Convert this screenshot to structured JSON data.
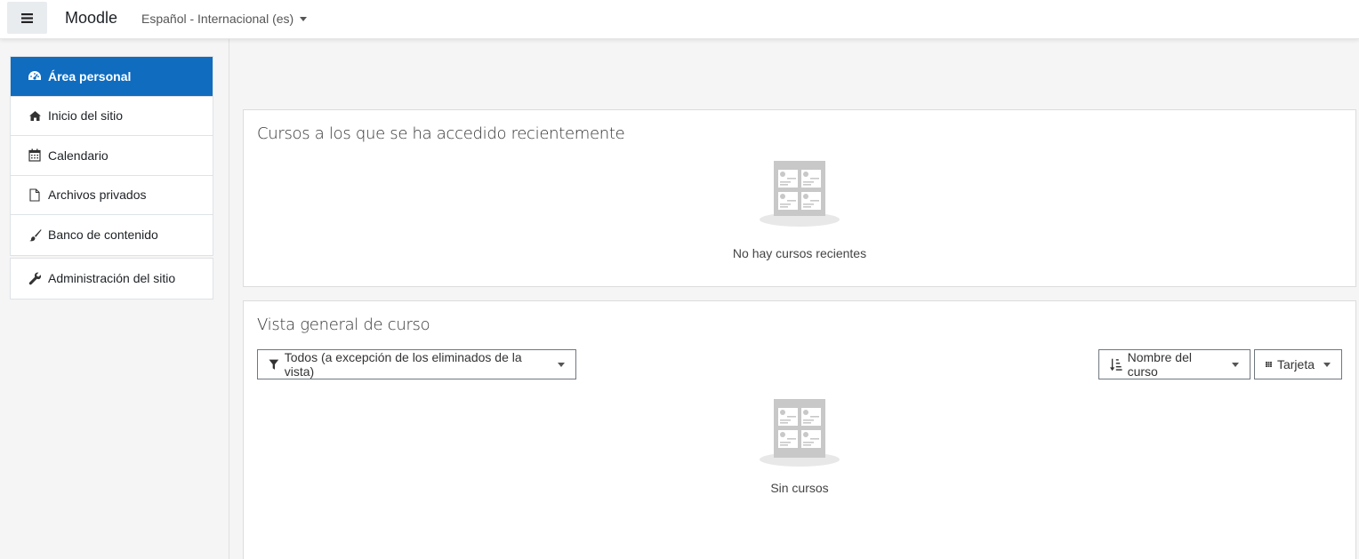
{
  "navbar": {
    "menu_icon": "hamburger-icon",
    "brand": "Moodle",
    "language": "Español - Internacional (es)"
  },
  "drawer": {
    "items": [
      {
        "label": "Área personal",
        "icon": "dashboard-icon",
        "active": true
      },
      {
        "label": "Inicio del sitio",
        "icon": "home-icon"
      },
      {
        "label": "Calendario",
        "icon": "calendar-icon"
      },
      {
        "label": "Archivos privados",
        "icon": "file-icon"
      },
      {
        "label": "Banco de contenido",
        "icon": "paint-brush-icon"
      }
    ],
    "admin": {
      "label": "Administración del sitio",
      "icon": "wrench-icon"
    }
  },
  "recent": {
    "title": "Cursos a los que se ha accedido recientemente",
    "empty_text": "No hay cursos recientes"
  },
  "overview": {
    "title": "Vista general de curso",
    "filter_label": "Todos (a excepción de los eliminados de la vista)",
    "sort_label": "Nombre del curso",
    "view_label": "Tarjeta",
    "empty_text": "Sin cursos"
  },
  "colors": {
    "accent": "#0f6cbf",
    "placeholder_gray": "#c8c8c8"
  }
}
